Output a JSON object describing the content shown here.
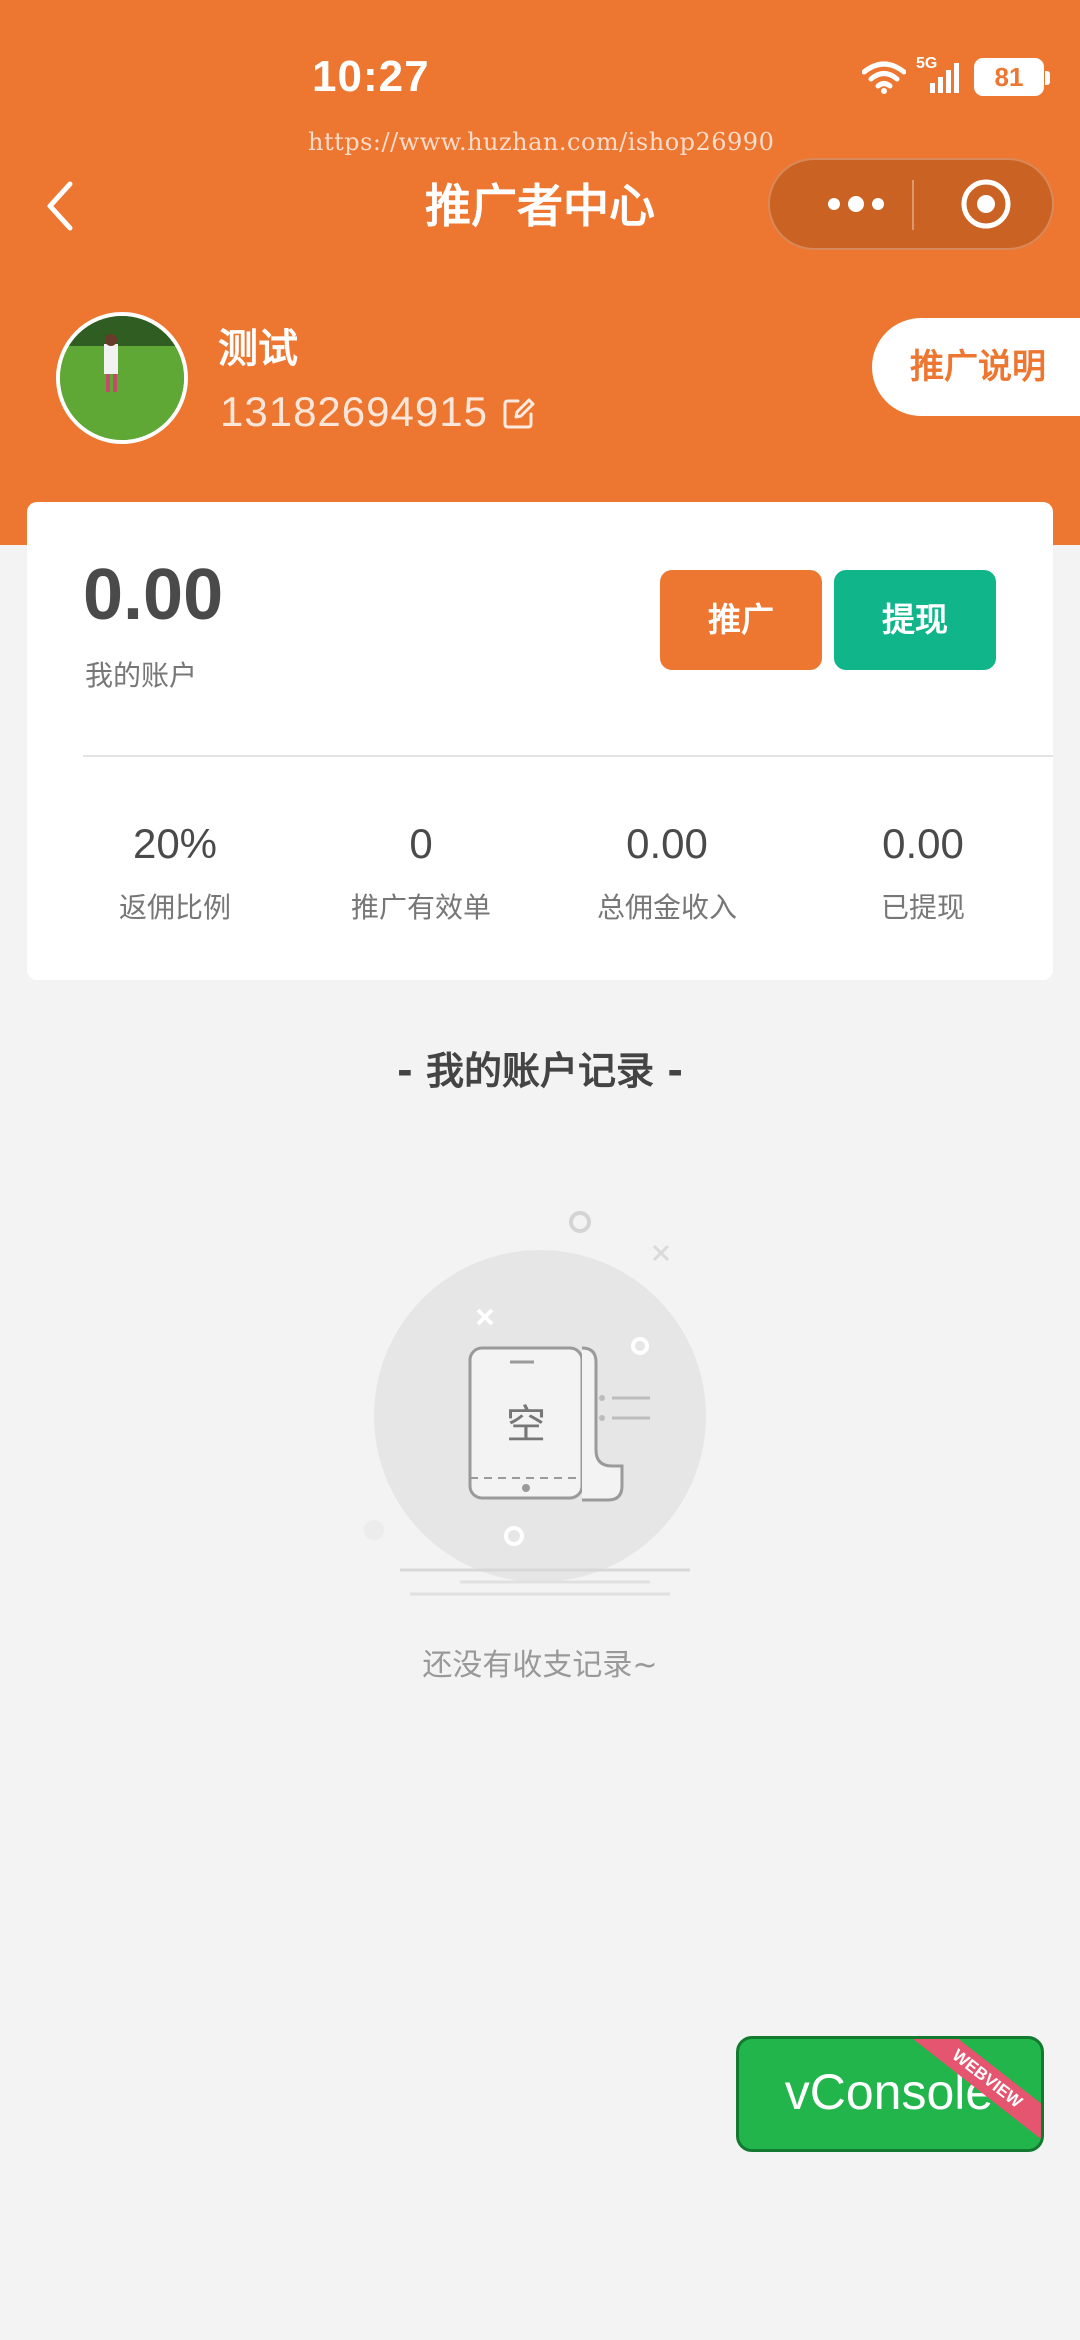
{
  "status_bar": {
    "time": "10:27",
    "network": "5G",
    "battery": "81"
  },
  "watermark": "https://www.huzhan.com/ishop26990",
  "header": {
    "title": "推广者中心"
  },
  "user": {
    "name": "测试",
    "phone": "13182694915"
  },
  "promo_note_button": "推广说明",
  "account": {
    "balance": "0.00",
    "label": "我的账户"
  },
  "actions": {
    "promote": "推广",
    "withdraw": "提现"
  },
  "stats": [
    {
      "value": "20%",
      "label": "返佣比例"
    },
    {
      "value": "0",
      "label": "推广有效单"
    },
    {
      "value": "0.00",
      "label": "总佣金收入"
    },
    {
      "value": "0.00",
      "label": "已提现"
    }
  ],
  "records": {
    "title": "- 我的账户记录 -",
    "empty_icon_char": "空",
    "empty_text": "还没有收支记录~"
  },
  "vconsole": {
    "label": "vConsole",
    "ribbon": "WEBVIEW"
  },
  "colors": {
    "brand": "#ed7630",
    "withdraw": "#10b68a",
    "vconsole": "#21b54b"
  }
}
